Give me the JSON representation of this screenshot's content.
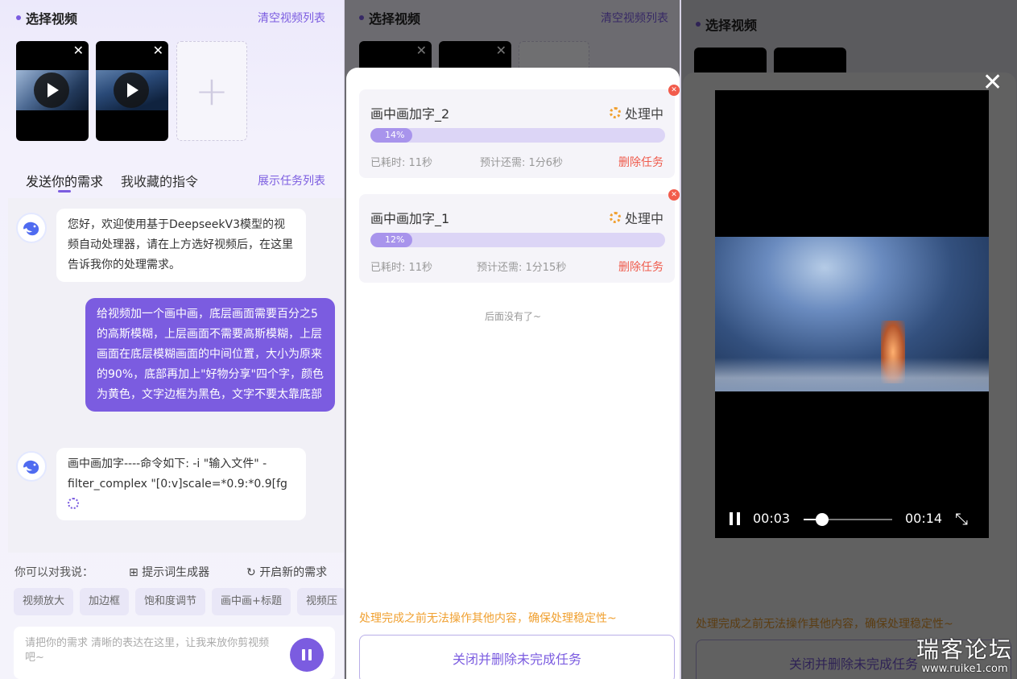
{
  "left": {
    "header": "选择视频",
    "clear_link": "清空视频列表",
    "tabs": [
      "发送你的需求",
      "我收藏的指令"
    ],
    "task_list_link": "展示任务列表",
    "msg_bot1": "您好，欢迎使用基于DeepseekV3模型的视频自动处理器，请在上方选好视频后，在这里告诉我你的处理需求。",
    "msg_user": "给视频加一个画中画，底层画面需要百分之5的高斯模糊，上层画面不需要高斯模糊，上层画面在底层模糊画面的中间位置，大小为原来的90%，底部再加上\"好物分享\"四个字，颜色为黄色，文字边框为黑色，文字不要太靠底部",
    "msg_bot2": "画中画加字----命令如下: -i \"输入文件\" -filter_complex \"[0:v]scale=*0.9:*0.9[fg",
    "say_label": "你可以对我说：",
    "prompt_gen": "提示词生成器",
    "new_req": "开启新的需求",
    "chips": [
      "视频放大",
      "加边框",
      "饱和度调节",
      "画中画+标题",
      "视频压"
    ],
    "input_placeholder": "请把你的需求 清晰的表达在这里，让我来放你剪视频吧~"
  },
  "middle": {
    "tasks": [
      {
        "name": "画中画加字_2",
        "status": "处理中",
        "progress": 0.14,
        "progress_label": "14%",
        "elapsed": "已耗时: 11秒",
        "remaining": "预计还需: 1分6秒",
        "delete": "删除任务"
      },
      {
        "name": "画中画加字_1",
        "status": "处理中",
        "progress": 0.12,
        "progress_label": "12%",
        "elapsed": "已耗时: 11秒",
        "remaining": "预计还需: 1分15秒",
        "delete": "删除任务"
      }
    ],
    "no_more": "后面没有了~",
    "warning": "处理完成之前无法操作其他内容，确保处理稳定性~",
    "close_button": "关闭并删除未完成任务"
  },
  "right": {
    "current_time": "00:03",
    "duration": "00:14",
    "played_fraction": 0.21
  },
  "watermark": {
    "name": "瑞客论坛",
    "url": "www.ruike1.com"
  },
  "colors": {
    "accent": "#7b5ce0",
    "warning": "#f0a030",
    "danger": "#ef5b4c"
  }
}
